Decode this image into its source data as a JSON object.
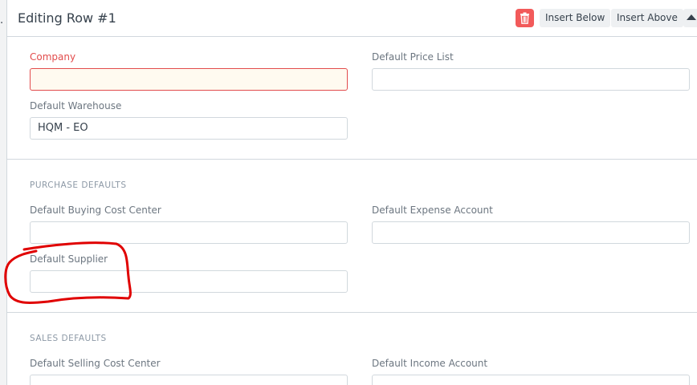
{
  "edge_glyph": ".",
  "header": {
    "title": "Editing Row #1",
    "delete_icon": "trash-icon",
    "insert_below_label": "Insert Below",
    "insert_above_label": "Insert Above",
    "collapse_icon": "triangle-up-icon"
  },
  "general": {
    "company": {
      "label": "Company",
      "value": "",
      "required": true
    },
    "default_price_list": {
      "label": "Default Price List",
      "value": ""
    },
    "default_warehouse": {
      "label": "Default Warehouse",
      "value": "HQM - EO"
    }
  },
  "purchase_defaults": {
    "heading": "PURCHASE DEFAULTS",
    "buying_cost_center": {
      "label": "Default Buying Cost Center",
      "value": ""
    },
    "expense_account": {
      "label": "Default Expense Account",
      "value": ""
    },
    "supplier": {
      "label": "Default Supplier",
      "value": ""
    }
  },
  "sales_defaults": {
    "heading": "SALES DEFAULTS",
    "selling_cost_center": {
      "label": "Default Selling Cost Center",
      "value": ""
    },
    "income_account": {
      "label": "Default Income Account",
      "value": ""
    }
  },
  "colors": {
    "delete_button": "#f25a5a",
    "required_label": "#e24c4c",
    "annotation_stroke": "#e00000"
  }
}
